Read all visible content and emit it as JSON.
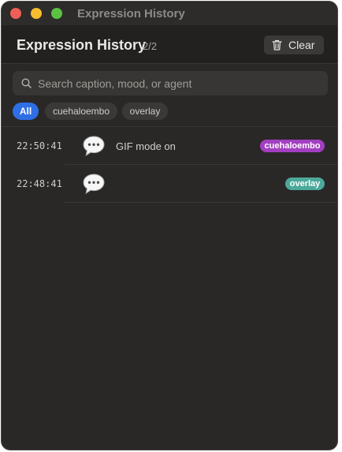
{
  "window": {
    "title": "Expression History"
  },
  "header": {
    "title": "Expression History",
    "count": "2/2",
    "clear_label": "Clear"
  },
  "search": {
    "placeholder": "Search caption, mood, or agent",
    "value": ""
  },
  "filters": [
    {
      "label": "All",
      "active": true
    },
    {
      "label": "cuehaloembo",
      "active": false
    },
    {
      "label": "overlay",
      "active": false
    }
  ],
  "entries": [
    {
      "time": "22:50:41",
      "icon": "speech-bubble-icon",
      "caption": "GIF mode on",
      "agent": "cuehaloembo",
      "agent_color": "#a33fc1"
    },
    {
      "time": "22:48:41",
      "icon": "speech-bubble-icon",
      "caption": "",
      "agent": "overlay",
      "agent_color": "#4ba99a"
    }
  ],
  "colors": {
    "accent": "#2f6fe6",
    "background": "#2a2827"
  }
}
